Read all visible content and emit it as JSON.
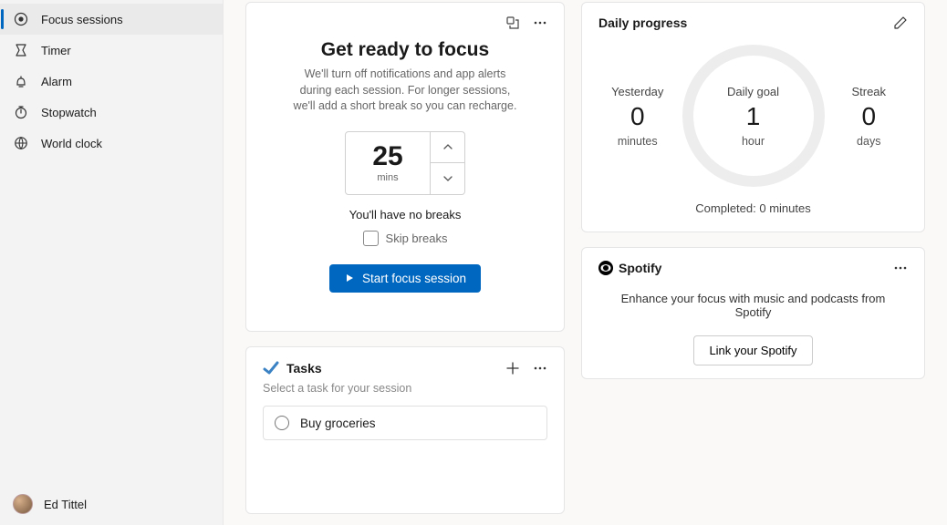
{
  "sidebar": {
    "items": [
      {
        "label": "Focus sessions",
        "icon": "focus-icon",
        "active": true
      },
      {
        "label": "Timer",
        "icon": "timer-icon",
        "active": false
      },
      {
        "label": "Alarm",
        "icon": "alarm-icon",
        "active": false
      },
      {
        "label": "Stopwatch",
        "icon": "stopwatch-icon",
        "active": false
      },
      {
        "label": "World clock",
        "icon": "world-clock-icon",
        "active": false
      }
    ],
    "user_name": "Ed Tittel"
  },
  "focus": {
    "title": "Get ready to focus",
    "subtitle": "We'll turn off notifications and app alerts during each session. For longer sessions, we'll add a short break so you can recharge.",
    "minutes": "25",
    "minutes_unit": "mins",
    "breaks_text": "You'll have no breaks",
    "skip_label": "Skip breaks",
    "start_label": "Start focus session"
  },
  "tasks": {
    "title": "Tasks",
    "subtitle": "Select a task for your session",
    "items": [
      {
        "label": "Buy groceries"
      }
    ]
  },
  "daily_progress": {
    "title": "Daily progress",
    "yesterday_label": "Yesterday",
    "yesterday_value": "0",
    "yesterday_unit": "minutes",
    "goal_label": "Daily goal",
    "goal_value": "1",
    "goal_unit": "hour",
    "streak_label": "Streak",
    "streak_value": "0",
    "streak_unit": "days",
    "completed_text": "Completed: 0 minutes"
  },
  "spotify": {
    "title": "Spotify",
    "text": "Enhance your focus with music and podcasts from Spotify",
    "button": "Link your Spotify"
  }
}
